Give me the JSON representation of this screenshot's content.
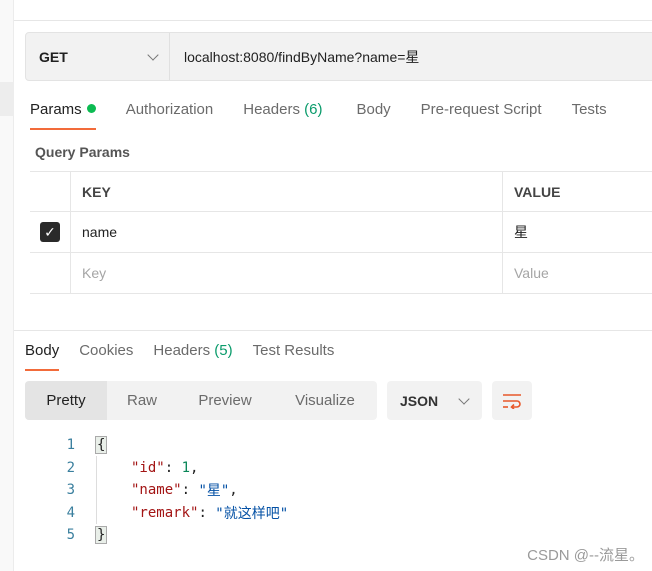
{
  "request": {
    "method": "GET",
    "url": "localhost:8080/findByName?name=星"
  },
  "request_tabs": [
    {
      "label": "Params",
      "active": true,
      "dot": true
    },
    {
      "label": "Authorization"
    },
    {
      "label": "Headers",
      "count": "(6)"
    },
    {
      "label": "Body"
    },
    {
      "label": "Pre-request Script"
    },
    {
      "label": "Tests"
    }
  ],
  "query_params": {
    "title": "Query Params",
    "headers": [
      "KEY",
      "VALUE"
    ],
    "rows": [
      {
        "checked": true,
        "key": "name",
        "value": "星"
      }
    ],
    "placeholder": {
      "key": "Key",
      "value": "Value"
    }
  },
  "response_tabs": [
    {
      "label": "Body",
      "active": true
    },
    {
      "label": "Cookies"
    },
    {
      "label": "Headers",
      "count": "(5)"
    },
    {
      "label": "Test Results"
    }
  ],
  "view_modes": [
    "Pretty",
    "Raw",
    "Preview",
    "Visualize"
  ],
  "format": "JSON",
  "code": {
    "lines": [
      "1",
      "2",
      "3",
      "4",
      "5"
    ],
    "open": "{",
    "close": "}",
    "id_key": "\"id\"",
    "id_val": "1",
    "name_key": "\"name\"",
    "name_val": "\"星\"",
    "remark_key": "\"remark\"",
    "remark_val": "\"就这样吧\""
  },
  "watermark": "CSDN @--流星。",
  "colors": {
    "accent": "#f26b3a",
    "dot": "#0cbb52",
    "count": "#0a9b6b"
  }
}
